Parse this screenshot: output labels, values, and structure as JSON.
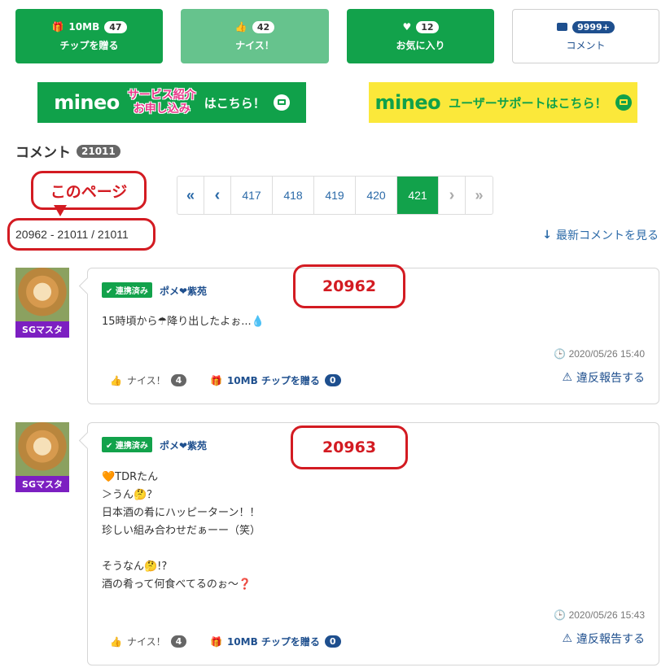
{
  "top_buttons": {
    "tip": {
      "amount": "10MB",
      "count": "47",
      "label": "チップを贈る",
      "icon": "gift-icon"
    },
    "nice": {
      "count": "42",
      "label": "ナイス！",
      "icon": "thumbs-up-icon"
    },
    "favorite": {
      "count": "12",
      "label": "お気に入り",
      "icon": "heart-icon"
    },
    "comment": {
      "count": "9999+",
      "label": "コメント",
      "icon": "speech-bubble-icon"
    }
  },
  "banners": {
    "left": {
      "logo": "mineo",
      "line1": "サービス紹介",
      "line2": "お申し込み",
      "cta": "はこちら！"
    },
    "right": {
      "logo": "mineo",
      "text": "ユーザーサポートはこちら！"
    }
  },
  "comments_header": {
    "title": "コメント",
    "count": "21011"
  },
  "annotation": {
    "this_page": "このページ"
  },
  "pagination": {
    "first": "«",
    "prev": "‹",
    "pages": [
      "417",
      "418",
      "419",
      "420",
      "421"
    ],
    "active": "421",
    "next": "›",
    "last": "»"
  },
  "range_text": "20962 - 21011 / 21011",
  "latest_link": "最新コメントを見る",
  "comments": [
    {
      "number_annotation": "20962",
      "rank": "SGマスタ",
      "linked_label": "連携済み",
      "user": "ポメ❤紫苑",
      "body": "15時頃から☂降り出したよぉ...💧",
      "timestamp": "2020/05/26 15:40",
      "nice_label": "ナイス！",
      "nice_count": "4",
      "tip_label": "10MB チップを贈る",
      "tip_count": "0",
      "report_label": "違反報告する"
    },
    {
      "number_annotation": "20963",
      "rank": "SGマスタ",
      "linked_label": "連携済み",
      "user": "ポメ❤紫苑",
      "body": "🧡TDRたん\n＞うん🤔？\n日本酒の肴にハッピーターン！！\n珍しい組み合わせだぁーー（笑）\n\nそうなん🤔!?\n酒の肴って何食べてるのぉ〜❓",
      "timestamp": "2020/05/26 15:43",
      "nice_label": "ナイス！",
      "nice_count": "4",
      "tip_label": "10MB チップを贈る",
      "tip_count": "0",
      "report_label": "違反報告する"
    }
  ],
  "colors": {
    "green": "#12a24b",
    "green_light": "#66c38d",
    "navy": "#1e4f8e",
    "annotation_red": "#d31b22",
    "rank_purple": "#7c1fc1"
  }
}
